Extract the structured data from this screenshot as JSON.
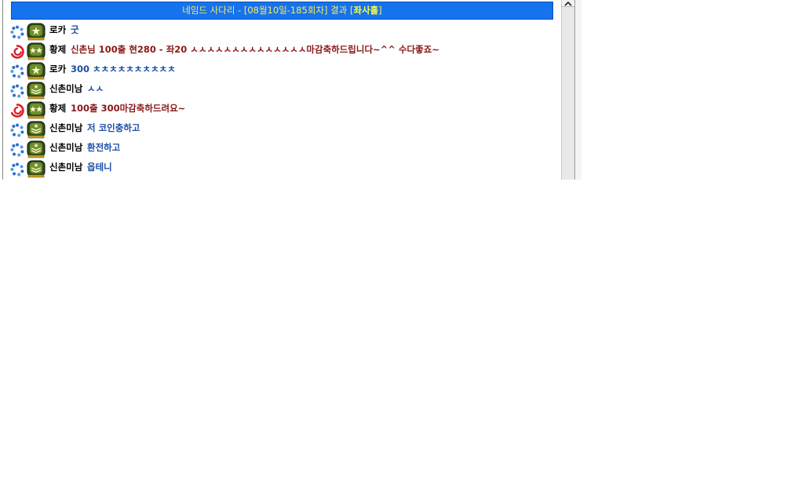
{
  "header": {
    "title_prefix": "네임드 사다리 - [08월10일-185회차] 결과 [",
    "result": "좌사홀",
    "title_suffix": "]"
  },
  "colors": {
    "header_bg": "#1673ee",
    "header_text": "#ffe95a",
    "message_blue": "#1a4ea6",
    "message_red": "#8b1818"
  },
  "chat": {
    "messages": [
      {
        "status_icon": "dotted-ring-icon",
        "rank_icon": "star-rank-badge-icon",
        "nick": "로카",
        "text": "굿",
        "color": "#1a4ea6"
      },
      {
        "status_icon": "swirl-icon",
        "rank_icon": "two-star-rank-badge-icon",
        "nick": "황제",
        "text": "신촌님 100출 현280 - 좌20 ㅅㅅㅅㅅㅅㅅㅅㅅㅅㅅㅅㅅㅅㅅ마감축하드립니다~^^ 수다좋죠~",
        "color": "#8b1818"
      },
      {
        "status_icon": "dotted-ring-icon",
        "rank_icon": "star-rank-badge-icon",
        "nick": "로카",
        "text": "300 ㅊㅊㅊㅊㅊㅊㅊㅊㅊㅊ",
        "color": "#1a4ea6"
      },
      {
        "status_icon": "dotted-ring-icon",
        "rank_icon": "chevron-rank-badge-icon",
        "nick": "신촌미남",
        "text": "ㅅㅅ",
        "color": "#1a4ea6"
      },
      {
        "status_icon": "swirl-icon",
        "rank_icon": "two-star-rank-badge-icon",
        "nick": "황제",
        "text": "100출 300마감축하드려요~",
        "color": "#8b1818"
      },
      {
        "status_icon": "dotted-ring-icon",
        "rank_icon": "chevron-rank-badge-icon",
        "nick": "신촌미남",
        "text": "저 코인충하고",
        "color": "#1a4ea6"
      },
      {
        "status_icon": "dotted-ring-icon",
        "rank_icon": "chevron-rank-badge-icon",
        "nick": "신촌미남",
        "text": "환전하고",
        "color": "#1a4ea6"
      },
      {
        "status_icon": "dotted-ring-icon",
        "rank_icon": "chevron-rank-badge-icon",
        "nick": "신촌미남",
        "text": "옵테니",
        "color": "#1a4ea6"
      }
    ]
  }
}
